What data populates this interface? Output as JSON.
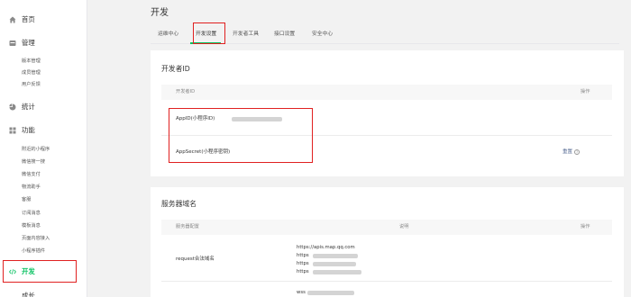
{
  "sidebar": {
    "home": {
      "label": "首页",
      "icon": "home-icon"
    },
    "manage": {
      "label": "管理",
      "icon": "manage-icon",
      "items": [
        "版本管理",
        "成员管理",
        "用户反馈"
      ]
    },
    "stats": {
      "label": "统计",
      "icon": "stats-icon"
    },
    "features": {
      "label": "功能",
      "icon": "grid-icon",
      "items": [
        "附近的小程序",
        "微信搜一搜",
        "微信支付",
        "物流助手",
        "客服",
        "订阅消息",
        "模板消息",
        "页面内容接入",
        "小程序插件"
      ]
    },
    "develop": {
      "label": "开发",
      "icon": "code-icon",
      "active": true
    },
    "growth": {
      "label": "成长"
    }
  },
  "page": {
    "title": "开发",
    "tabs": [
      "运维中心",
      "开发设置",
      "开发者工具",
      "接口设置",
      "安全中心"
    ],
    "active_tab": "开发设置"
  },
  "developer_id": {
    "title": "开发者ID",
    "col_id": "开发者ID",
    "col_action": "操作",
    "appid_label": "AppID(小程序ID)",
    "appsecret_label": "AppSecret(小程序密钥)",
    "reset_label": "重置",
    "help_icon": "?"
  },
  "server_domain": {
    "title": "服务器域名",
    "col_config": "服务器配置",
    "col_desc": "说明",
    "col_action": "操作",
    "request_label": "request合法域名",
    "request_urls": [
      "https://apis.map.qq.com",
      "https",
      "https",
      "https"
    ],
    "socket_prefix": "wss"
  },
  "colors": {
    "accent": "#07c160",
    "highlight": "#e02020",
    "link": "#576b95"
  }
}
